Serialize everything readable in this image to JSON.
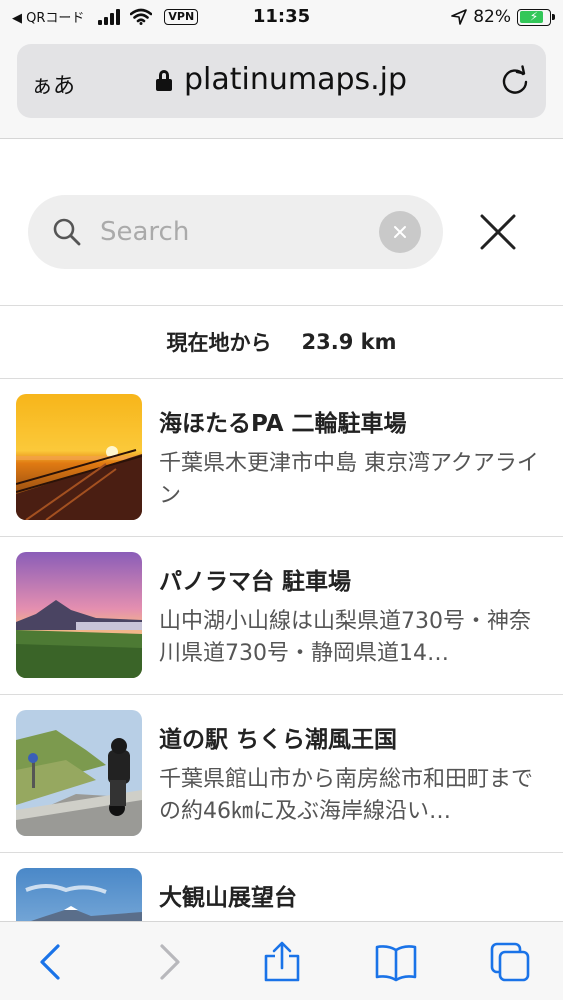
{
  "status_bar": {
    "back_label": "◀ QRコード",
    "vpn": "VPN",
    "time": "11:35",
    "battery": "82%"
  },
  "browser": {
    "aa_label": "ぁあ",
    "url": "platinumaps.jp"
  },
  "search": {
    "placeholder": "Search",
    "value": ""
  },
  "distance": {
    "label": "現在地から",
    "value": "23.9 km"
  },
  "places": [
    {
      "title": "海ほたるPA 二輪駐車場",
      "description": "千葉県木更津市中島 東京湾アクアライン"
    },
    {
      "title": "パノラマ台 駐車場",
      "description": "山中湖小山線は山梨県道730号・神奈川県道730号・静岡県道14…"
    },
    {
      "title": "道の駅 ちくら潮風王国",
      "description": "千葉県館山市から南房総市和田町までの約46㎞に及ぶ海岸線沿い…"
    },
    {
      "title": "大観山展望台",
      "description": ""
    }
  ],
  "colors": {
    "accent": "#1a73e8",
    "battery_green": "#33c759"
  },
  "icons": {
    "back": "chevron-left-icon",
    "forward": "chevron-right-icon",
    "share": "share-icon",
    "bookmarks": "book-icon",
    "tabs": "tabs-icon"
  }
}
